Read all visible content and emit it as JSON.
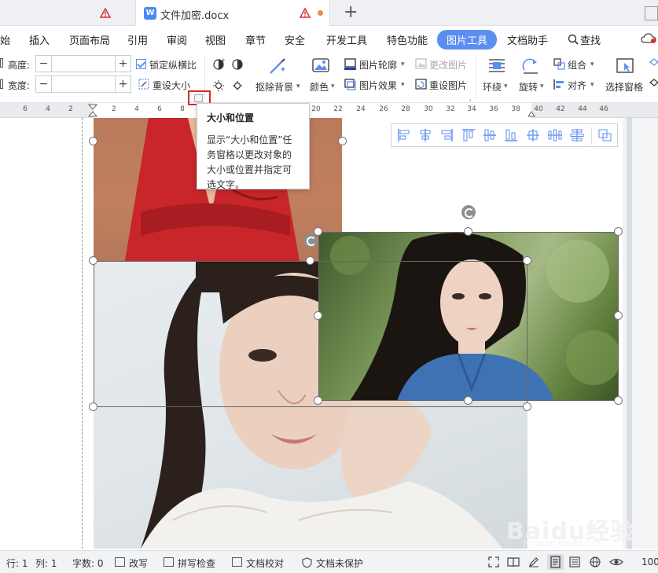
{
  "tabs": {
    "active_title": "文件加密.docx",
    "doc_icon_letter": "W",
    "new_tab": "+"
  },
  "menu": {
    "items": [
      "始",
      "插入",
      "页面布局",
      "引用",
      "审阅",
      "视图",
      "章节",
      "安全",
      "开发工具",
      "特色功能",
      "图片工具",
      "文档助手",
      "查找"
    ],
    "active": "图片工具"
  },
  "ribbon": {
    "height_label": "高度:",
    "width_label": "宽度:",
    "height_value": "",
    "width_value": "",
    "lock_ratio": "锁定纵横比",
    "reset_size": "重设大小",
    "remove_bg": "抠除背景",
    "color": "颜色",
    "pic_outline": "图片轮廓",
    "pic_effect": "图片效果",
    "change_pic": "更改图片",
    "reset_pic": "重设图片",
    "wrap": "环绕",
    "rotate": "旋转",
    "group": "组合",
    "align": "对齐",
    "select_pane": "选择窗格"
  },
  "ruler": {
    "ticks": [
      "6",
      "4",
      "2",
      "2",
      "4",
      "6",
      "8",
      "20",
      "22",
      "24",
      "26",
      "28",
      "30",
      "32",
      "34",
      "36",
      "38",
      "40",
      "42",
      "44",
      "46"
    ]
  },
  "tooltip": {
    "title": "大小和位置",
    "body": "显示“大小和位置”任务窗格以更改对象的大小或位置并指定可选文字。"
  },
  "status": {
    "row": "行: 1",
    "col": "列: 1",
    "words": "字数: 0",
    "revise": "改写",
    "spellcheck": "拼写检查",
    "proofread": "文档校对",
    "protect": "文档未保护",
    "zoom": "100"
  },
  "watermark": {
    "text": "Baidu经验",
    "sub": "jingyan.baidu.com"
  },
  "colors": {
    "accent": "#5c8ef2",
    "warning": "#e0252a",
    "modified_dot": "#f0883e"
  }
}
